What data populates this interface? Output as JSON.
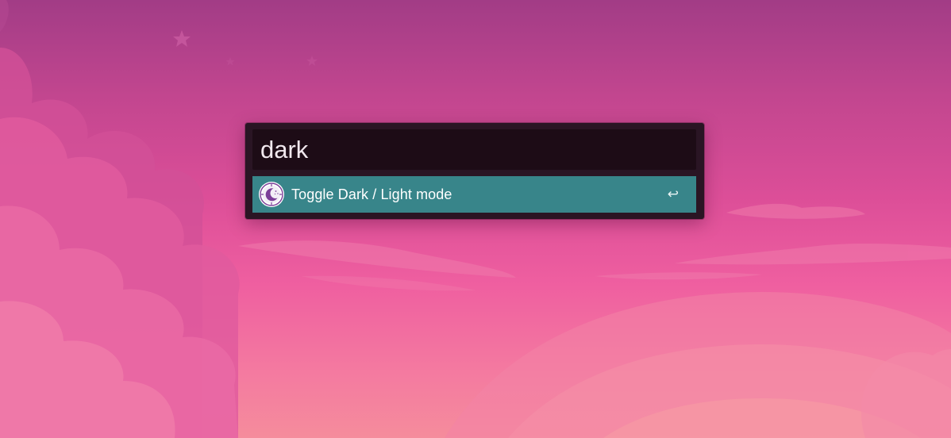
{
  "launcher": {
    "query": "dark",
    "results": [
      {
        "label": "Toggle Dark / Light mode",
        "icon": "moon-clock-icon",
        "hint": "↩"
      }
    ]
  },
  "colors": {
    "panel": "#2a1524",
    "search_field": "#1d0c16",
    "selected_result": "#38858a",
    "icon_accent": "#7b3e98"
  }
}
